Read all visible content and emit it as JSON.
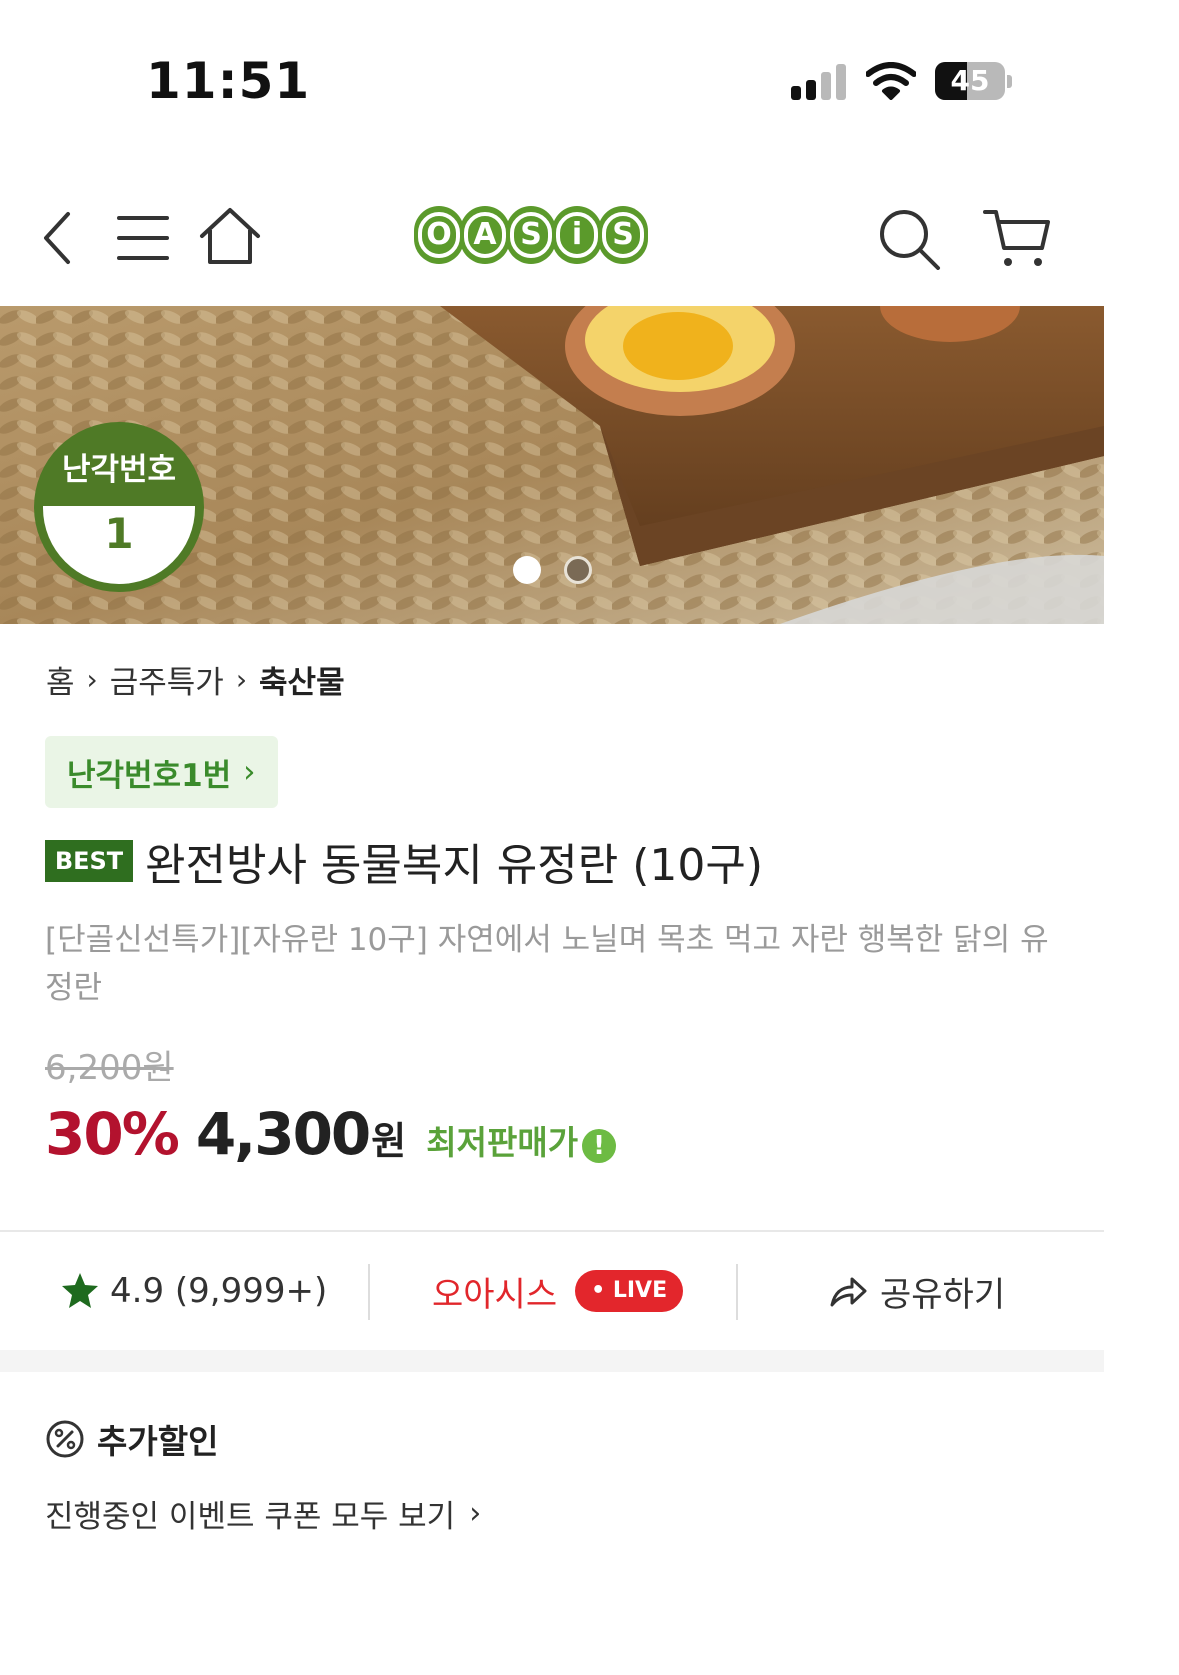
{
  "status_bar": {
    "time": "11:51",
    "battery": "45",
    "battery_level": 0.45
  },
  "header": {
    "logo_letters": [
      "O",
      "A",
      "S",
      "i",
      "S"
    ],
    "brand_color": "#5b9a2b",
    "icons": [
      "back-icon",
      "menu-icon",
      "home-icon",
      "search-icon",
      "cart-icon"
    ]
  },
  "hero": {
    "badge_top": "난각번호",
    "badge_number": "1",
    "carousel_total": 2,
    "carousel_active": 1
  },
  "breadcrumb": {
    "items": [
      "홈",
      "금주특가",
      "축산물"
    ],
    "separator": "›"
  },
  "category_tag": {
    "label": "난각번호1번",
    "chevron": "›"
  },
  "product": {
    "badge": "BEST",
    "title": "완전방사 동물복지 유정란 (10구)",
    "description": "[단골신선특가][자유란 10구] 자연에서 노닐며 목초 먹고 자란 행복한 닭의 유정란",
    "original_price": "6,200원",
    "discount": "30%",
    "sale_price": "4,300",
    "currency": "원",
    "lowest_label": "최저판매가",
    "info_glyph": "!"
  },
  "actions": {
    "rating": "4.9 (9,999+)",
    "live_label": "오아시스",
    "live_badge": "• LIVE",
    "share": "공유하기"
  },
  "extra_discount": {
    "title": "추가할인",
    "events_link": "진행중인 이벤트 쿠폰 모두 보기",
    "chevron": "›"
  },
  "colors": {
    "accent_red": "#b3122e",
    "live_red": "#e3262c",
    "green": "#2f6e1f"
  }
}
